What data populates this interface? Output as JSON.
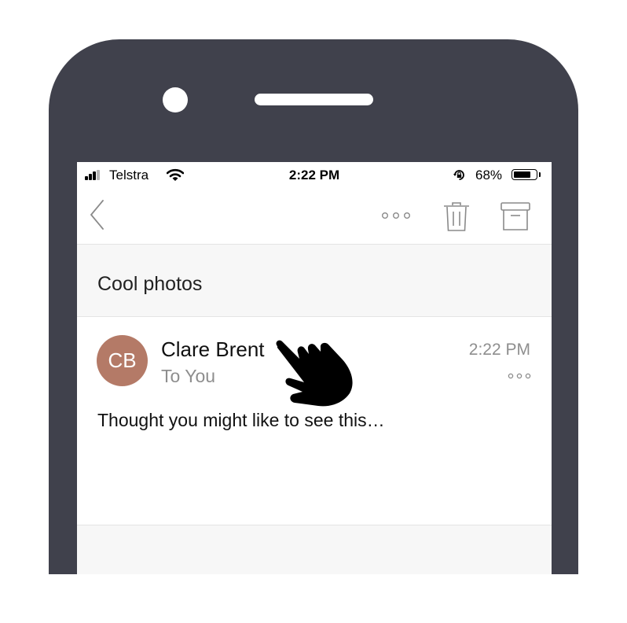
{
  "status_bar": {
    "carrier": "Telstra",
    "time": "2:22 PM",
    "battery_percent": "68%",
    "battery_level": 0.68
  },
  "toolbar": {
    "back_icon": "chevron-left-icon",
    "more_icon": "more-horizontal-icon",
    "delete_icon": "trash-icon",
    "archive_icon": "archive-icon"
  },
  "email": {
    "subject": "Cool photos",
    "sender_initials": "CB",
    "sender_name": "Clare Brent",
    "recipient": "To You",
    "time": "2:22 PM",
    "body_preview": "Thought you might like to see this…"
  },
  "colors": {
    "phone_frame": "#40414c",
    "avatar": "#b47a67",
    "secondary_text": "#8e8e8e",
    "subject_background": "#f7f7f7"
  }
}
